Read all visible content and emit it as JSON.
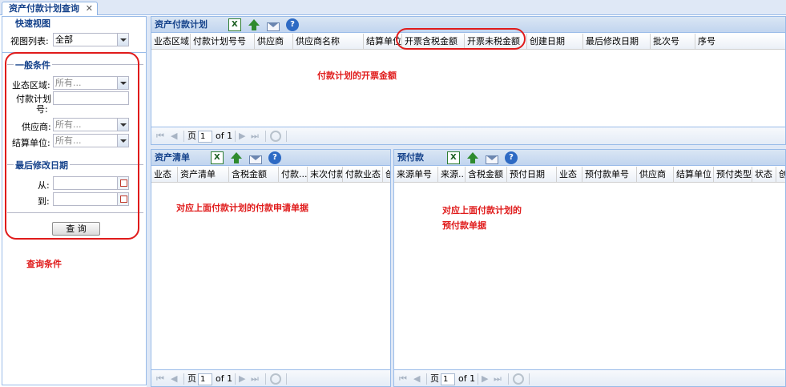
{
  "tab": {
    "title": "资产付款计划查询",
    "close": "✕"
  },
  "left": {
    "quick_view_title": "快速视图",
    "view_list_label": "视图列表:",
    "view_list_value": "全部",
    "general_title": "一般条件",
    "biz_area_label": "业态区域:",
    "biz_area_placeholder": "所有...",
    "plan_no_label_1": "付款计划",
    "plan_no_label_2": "号:",
    "supplier_label": "供应商:",
    "supplier_placeholder": "所有...",
    "settle_unit_label": "结算单位:",
    "settle_unit_placeholder": "所有...",
    "date_title": "最后修改日期",
    "from_label": "从:",
    "to_label": "到:",
    "query_button": "查 询"
  },
  "top_panel": {
    "title": "资产付款计划",
    "columns": [
      "业态区域",
      "付款计划号号",
      "供应商",
      "供应商名称",
      "结算单位",
      "开票含税金额",
      "开票未税金额",
      "创建日期",
      "最后修改日期",
      "批次号",
      "序号"
    ]
  },
  "assets_panel": {
    "title": "资产清单",
    "columns": [
      "业态",
      "资产清单",
      "含税金额",
      "付款...",
      "末次付款",
      "付款业态",
      "创"
    ]
  },
  "prepay_panel": {
    "title": "预付款",
    "columns": [
      "来源单号",
      "来源...",
      "含税金额",
      "预付日期",
      "业态",
      "预付款单号",
      "供应商",
      "结算单位",
      "预付类型",
      "状态",
      "创"
    ]
  },
  "pager": {
    "page_label": "页",
    "page_value": "1",
    "of_label": "of 1",
    "first": "⏮",
    "prev": "◀",
    "next": "▶",
    "last": "⏭"
  },
  "annotations": {
    "top": "付款计划的开票金额",
    "assets": "对应上面付款计划的付款申请单据",
    "prepay_1": "对应上面付款计划的",
    "prepay_2": "预付款单据",
    "query": "查询条件"
  },
  "icons": [
    "excel-export-icon",
    "upload-icon",
    "mail-icon",
    "help-icon"
  ],
  "colors": {
    "header_blue": "#15428b",
    "border_blue": "#99bbe8",
    "annotation_red": "#e01b1b"
  }
}
